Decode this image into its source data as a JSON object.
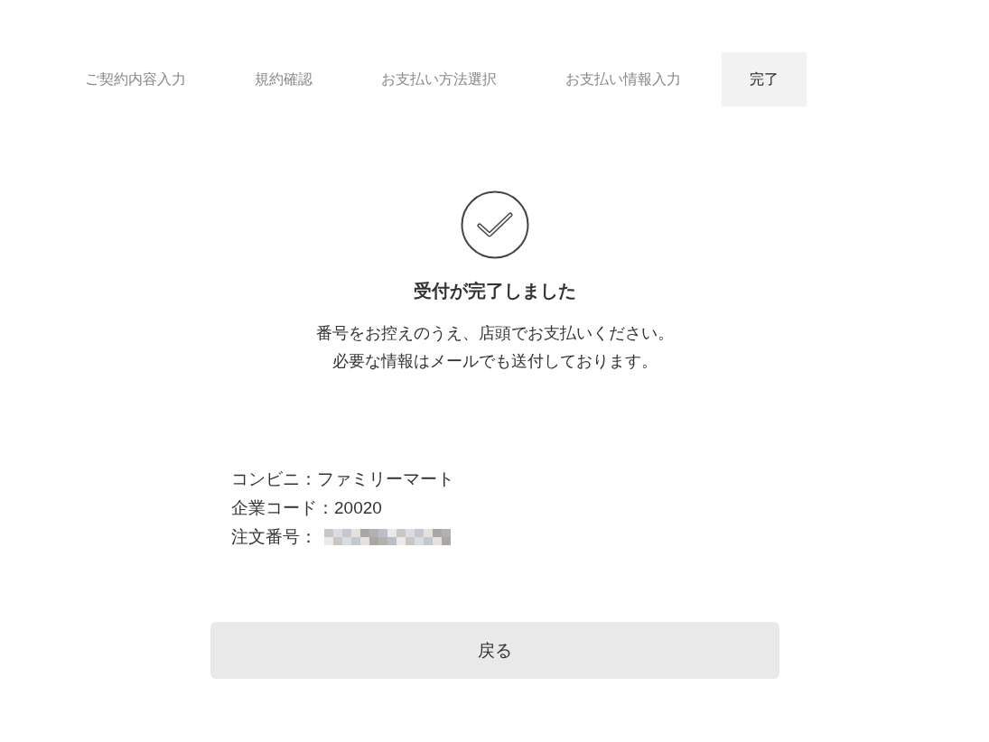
{
  "steps": [
    {
      "label": "ご契約内容入力",
      "selected": false
    },
    {
      "label": "規約確認",
      "selected": false
    },
    {
      "label": "お支払い方法選択",
      "selected": false
    },
    {
      "label": "お支払い情報入力",
      "selected": false
    },
    {
      "label": "完了",
      "selected": true
    }
  ],
  "title": "受付が完了しました",
  "message": [
    "番号をお控えのうえ、店頭でお支払いください。",
    "必要な情報はメールでも送付しております。"
  ],
  "details": [
    {
      "label": "コンビニ：",
      "value": "ファミリーマート",
      "redacted": false
    },
    {
      "label": "企業コード：",
      "value": " 20020",
      "redacted": false
    },
    {
      "label": "注文番号：",
      "redacted": true
    }
  ],
  "back_button": "戻る"
}
